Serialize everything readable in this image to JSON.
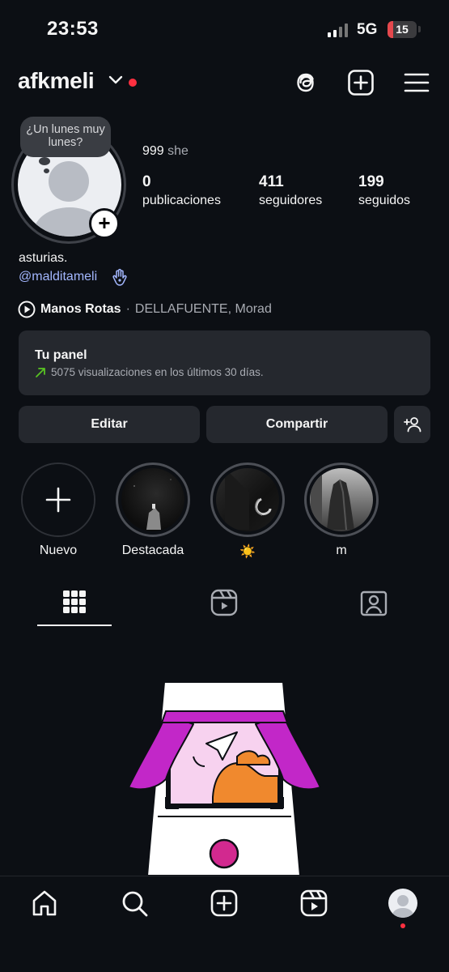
{
  "status_bar": {
    "time": "23:53",
    "network": "5G",
    "battery": "15"
  },
  "header": {
    "username": "afkmeli",
    "icons": [
      "threads-icon",
      "create-post-icon",
      "menu-icon"
    ]
  },
  "profile": {
    "note": "¿Un lunes muy lunes?",
    "pronouns_num": "999",
    "pronouns": "she",
    "stats": [
      {
        "value": "0",
        "label": "publicaciones"
      },
      {
        "value": "411",
        "label": "seguidores"
      },
      {
        "value": "199",
        "label": "seguidos"
      }
    ],
    "bio": "asturias.",
    "mention": "@malditameli",
    "music": {
      "song": "Manos Rotas",
      "separator": "·",
      "artist": "DELLAFUENTE, Morad"
    }
  },
  "panel": {
    "title": "Tu panel",
    "subtitle": "5075 visualizaciones en los últimos 30 días."
  },
  "actions": {
    "edit": "Editar",
    "share": "Compartir"
  },
  "highlights": [
    {
      "label": "Nuevo"
    },
    {
      "label": "Destacada"
    },
    {
      "label": "☀️"
    },
    {
      "label": "m"
    }
  ],
  "tabs": [
    "grid-icon",
    "reels-icon",
    "tagged-icon"
  ],
  "colors": {
    "background": "#0c0f14",
    "card": "#25282e",
    "accent_red": "#ff3040",
    "mention": "#a3b7ff"
  }
}
